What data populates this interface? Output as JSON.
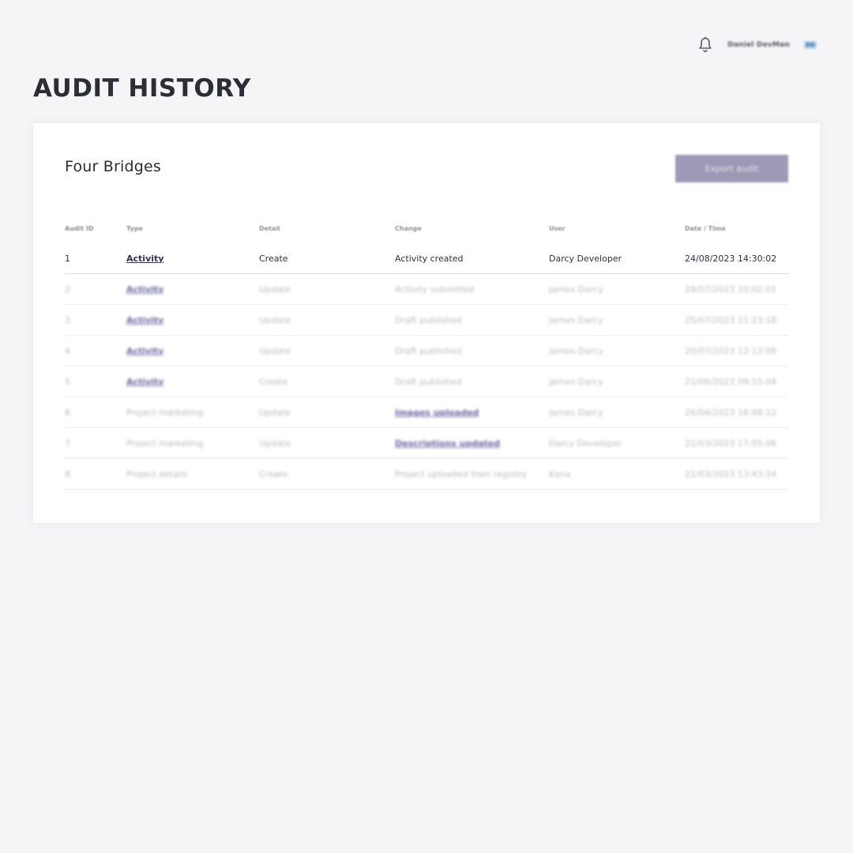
{
  "header": {
    "user_name": "Daniel DevMan",
    "avatar_initials": "DD",
    "notification_icon": "bell-icon"
  },
  "page": {
    "title": "AUDIT HISTORY"
  },
  "card": {
    "title": "Four Bridges",
    "export_label": "Export audit"
  },
  "table": {
    "columns": [
      "Audit ID",
      "Type",
      "Detail",
      "Change",
      "User",
      "Date / Time"
    ],
    "rows": [
      {
        "id": "1",
        "type": "Activity",
        "detail": "Create",
        "change": "Activity created",
        "user": "Darcy Developer",
        "datetime": "24/08/2023 14:30:02"
      },
      {
        "id": "2",
        "type": "Activity",
        "detail": "Update",
        "change": "Activity submitted",
        "user": "James Darcy",
        "datetime": "28/07/2023 10:02:01"
      },
      {
        "id": "3",
        "type": "Activity",
        "detail": "Update",
        "change": "Draft published",
        "user": "James Darcy",
        "datetime": "25/07/2023 11:23:18"
      },
      {
        "id": "4",
        "type": "Activity",
        "detail": "Update",
        "change": "Draft published",
        "user": "James Darcy",
        "datetime": "20/07/2023 12:12:08"
      },
      {
        "id": "5",
        "type": "Activity",
        "detail": "Create",
        "change": "Draft published",
        "user": "James Darcy",
        "datetime": "21/06/2023 09:15:04"
      },
      {
        "id": "6",
        "type": "Project marketing",
        "detail": "Update",
        "change": "Images uploaded",
        "user": "James Darcy",
        "datetime": "26/04/2023 16:08:12"
      },
      {
        "id": "7",
        "type": "Project marketing",
        "detail": "Update",
        "change": "Descriptions updated",
        "user": "Darcy Developer",
        "datetime": "21/03/2023 17:05:06"
      },
      {
        "id": "8",
        "type": "Project details",
        "detail": "Create",
        "change": "Project uploaded from registry",
        "user": "Kana",
        "datetime": "21/03/2023 13:43:34"
      }
    ]
  },
  "colors": {
    "background": "#f5f5f8",
    "card": "#ffffff",
    "title": "#2b2d37",
    "button": "#9b99b4",
    "link": "#353155"
  }
}
